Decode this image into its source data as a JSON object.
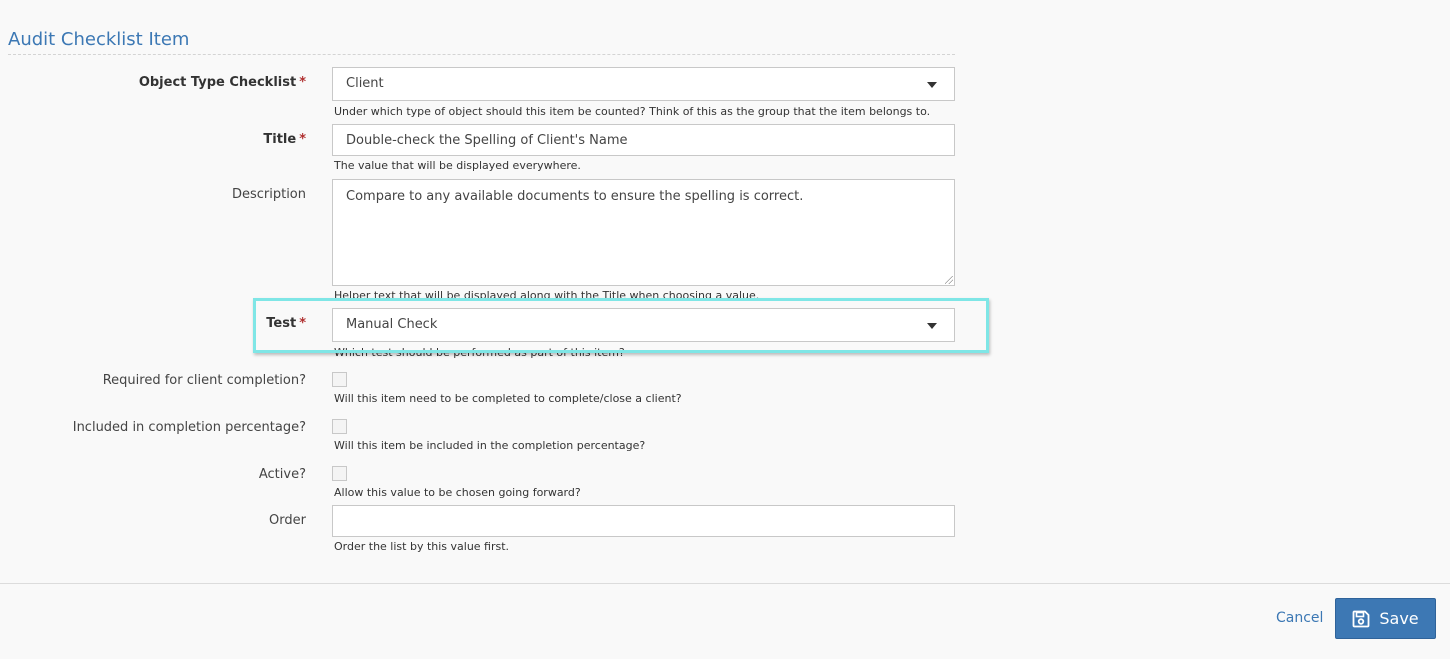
{
  "form": {
    "section_title": "Audit Checklist Item",
    "required_marker": "*",
    "object_type": {
      "label": "Object Type Checklist",
      "value": "Client",
      "help": "Under which type of object should this item be counted? Think of this as the group that the item belongs to."
    },
    "title": {
      "label": "Title",
      "value": "Double-check the Spelling of Client's Name",
      "help": "The value that will be displayed everywhere."
    },
    "description": {
      "label": "Description",
      "value": "Compare to any available documents to ensure the spelling is correct.",
      "help": "Helper text that will be displayed along with the Title when choosing a value."
    },
    "test": {
      "label": "Test",
      "value": "Manual Check",
      "help": "Which test should be performed as part of this item?"
    },
    "required_for_completion": {
      "label": "Required for client completion?",
      "checked": false,
      "help": "Will this item need to be completed to complete/close a client?"
    },
    "included_in_percentage": {
      "label": "Included in completion percentage?",
      "checked": false,
      "help": "Will this item be included in the completion percentage?"
    },
    "active": {
      "label": "Active?",
      "checked": false,
      "help": "Allow this value to be chosen going forward?"
    },
    "order": {
      "label": "Order",
      "value": "",
      "help": "Order the list by this value first."
    }
  },
  "footer": {
    "cancel_label": "Cancel",
    "save_label": "Save"
  },
  "colors": {
    "accent": "#3c78b4",
    "highlight": "#7fe6e6",
    "required_star": "#b03030"
  },
  "icons": {
    "save": "save-icon",
    "dropdown": "chevron-down-icon"
  }
}
